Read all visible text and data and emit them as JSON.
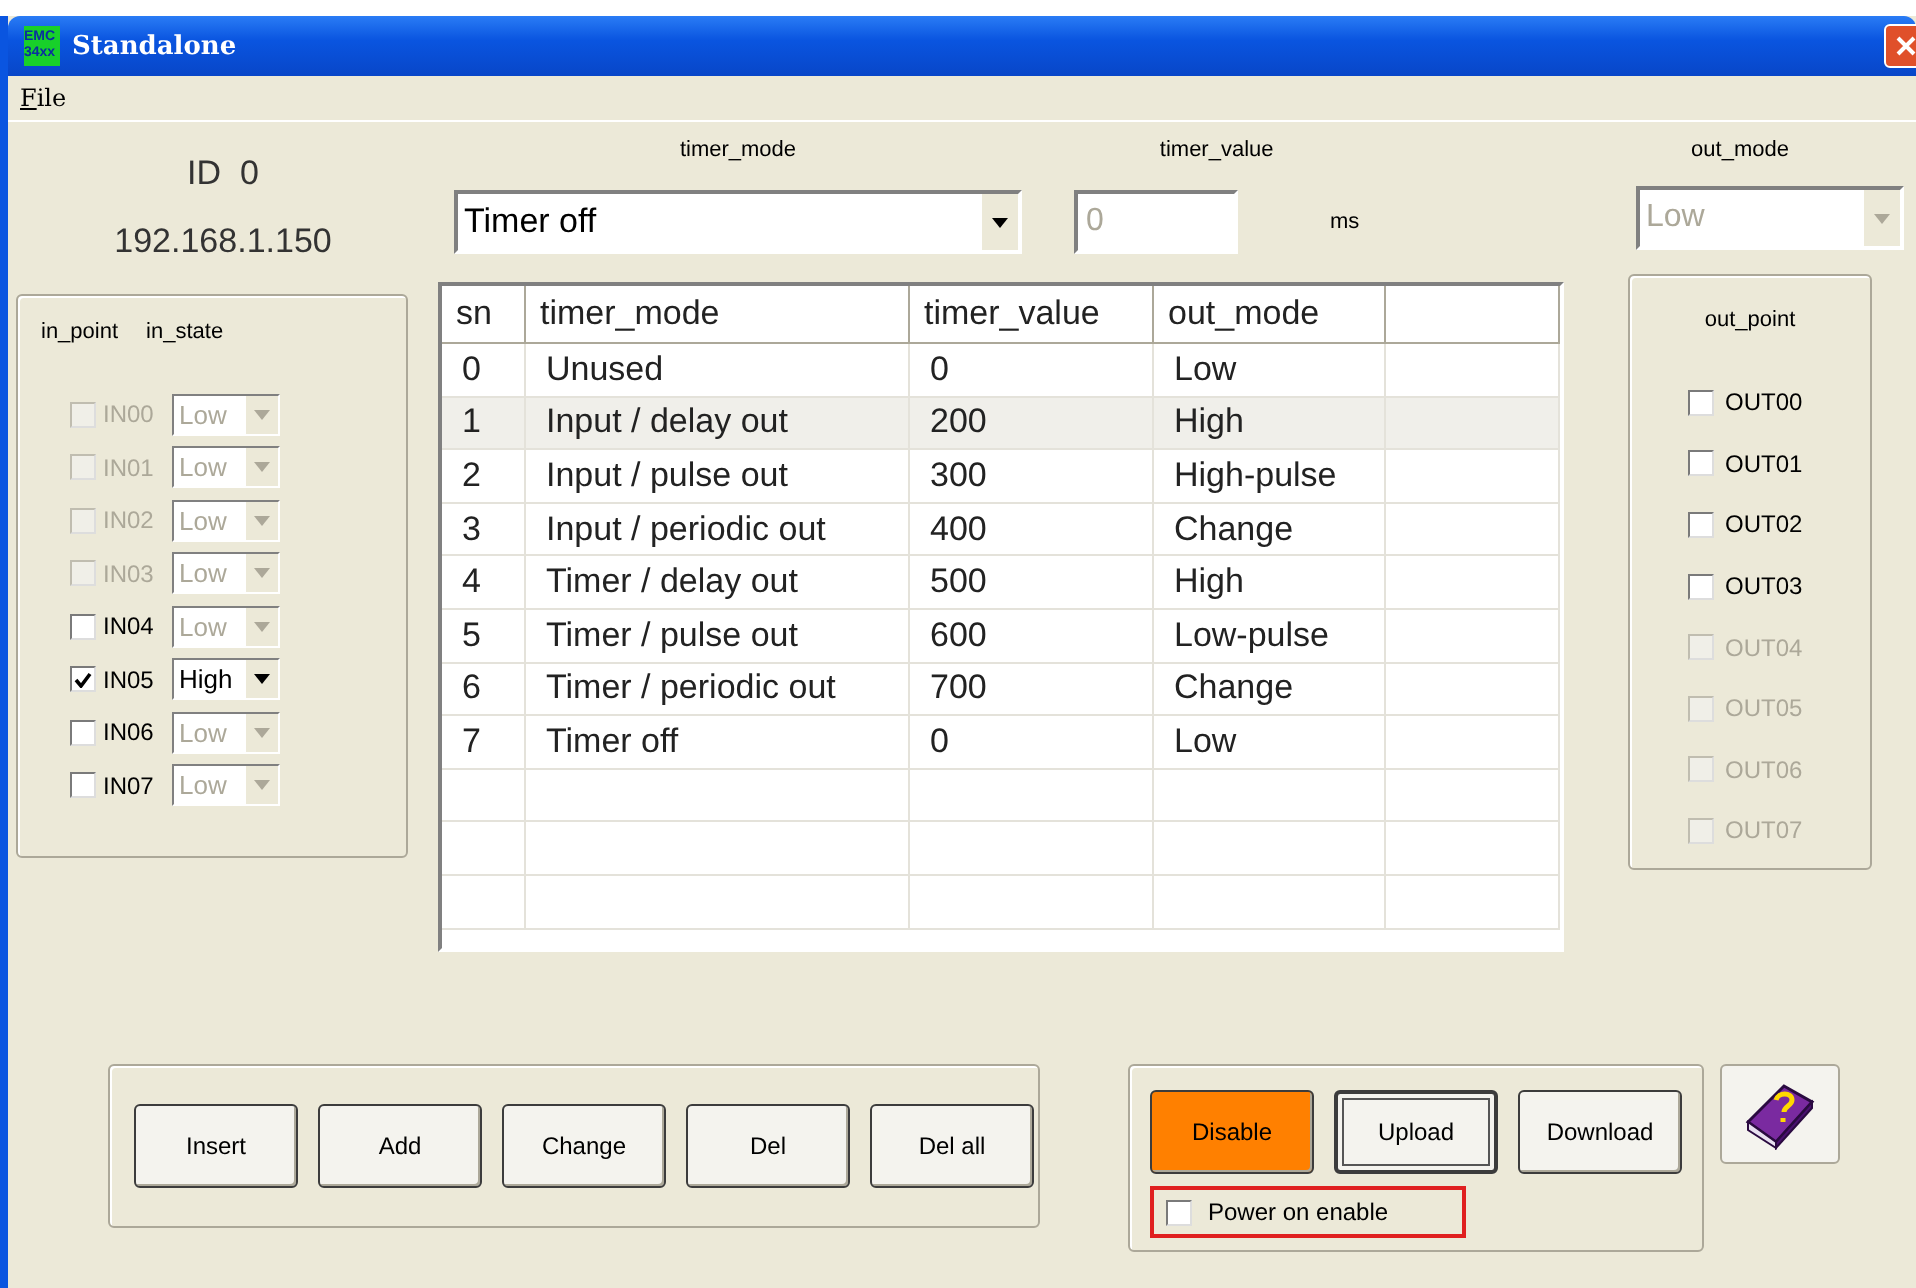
{
  "window": {
    "title": "Standalone",
    "app_icon": [
      "EMC",
      "34xx"
    ]
  },
  "menu": [
    "File"
  ],
  "device": {
    "id": "ID  0",
    "ip": "192.168.1.150"
  },
  "inputs": {
    "headers": [
      "in_point",
      "in_state"
    ],
    "points": [
      {
        "label": "IN00",
        "checked": false,
        "disabled": true,
        "state": "Low",
        "state_disabled": true
      },
      {
        "label": "IN01",
        "checked": false,
        "disabled": true,
        "state": "Low",
        "state_disabled": true
      },
      {
        "label": "IN02",
        "checked": false,
        "disabled": true,
        "state": "Low",
        "state_disabled": true
      },
      {
        "label": "IN03",
        "checked": false,
        "disabled": true,
        "state": "Low",
        "state_disabled": true
      },
      {
        "label": "IN04",
        "checked": false,
        "disabled": false,
        "state": "Low",
        "state_disabled": true
      },
      {
        "label": "IN05",
        "checked": true,
        "disabled": false,
        "state": "High",
        "state_disabled": false
      },
      {
        "label": "IN06",
        "checked": false,
        "disabled": false,
        "state": "Low",
        "state_disabled": true
      },
      {
        "label": "IN07",
        "checked": false,
        "disabled": false,
        "state": "Low",
        "state_disabled": true
      }
    ]
  },
  "timer_mode": {
    "label": "timer_mode",
    "value": "Timer off"
  },
  "timer_value": {
    "label": "timer_value",
    "value": "0",
    "unit": "ms",
    "disabled": true
  },
  "out_mode": {
    "label": "out_mode",
    "value": "Low",
    "disabled": true
  },
  "table": {
    "columns": [
      "sn",
      "timer_mode",
      "timer_value",
      "out_mode"
    ],
    "rows": [
      {
        "cells": [
          "0",
          "Unused",
          "0",
          "Low"
        ],
        "selected": false
      },
      {
        "cells": [
          "1",
          "Input / delay out",
          "200",
          "High"
        ],
        "selected": true
      },
      {
        "cells": [
          "2",
          "Input / pulse out",
          "300",
          "High-pulse"
        ],
        "selected": false
      },
      {
        "cells": [
          "3",
          "Input / periodic out",
          "400",
          "Change"
        ],
        "selected": false
      },
      {
        "cells": [
          "4",
          "Timer / delay out",
          "500",
          "High"
        ],
        "selected": false
      },
      {
        "cells": [
          "5",
          "Timer / pulse out",
          "600",
          "Low-pulse"
        ],
        "selected": false
      },
      {
        "cells": [
          "6",
          "Timer / periodic out",
          "700",
          "Change"
        ],
        "selected": false
      },
      {
        "cells": [
          "7",
          "Timer off",
          "0",
          "Low"
        ],
        "selected": false
      }
    ]
  },
  "outputs": {
    "title": "out_point",
    "points": [
      {
        "label": "OUT00",
        "checked": false,
        "disabled": false
      },
      {
        "label": "OUT01",
        "checked": false,
        "disabled": false
      },
      {
        "label": "OUT02",
        "checked": false,
        "disabled": false
      },
      {
        "label": "OUT03",
        "checked": false,
        "disabled": false
      },
      {
        "label": "OUT04",
        "checked": false,
        "disabled": true
      },
      {
        "label": "OUT05",
        "checked": false,
        "disabled": true
      },
      {
        "label": "OUT06",
        "checked": false,
        "disabled": true
      },
      {
        "label": "OUT07",
        "checked": false,
        "disabled": true
      }
    ]
  },
  "edit_buttons": [
    "Insert",
    "Add",
    "Change",
    "Del",
    "Del all"
  ],
  "device_buttons": [
    {
      "label": "Disable",
      "kind": "warning"
    },
    {
      "label": "Upload",
      "kind": "focused"
    },
    {
      "label": "Download",
      "kind": "normal"
    }
  ],
  "power_on": {
    "label": "Power on enable",
    "checked": false,
    "highlighted": true
  }
}
